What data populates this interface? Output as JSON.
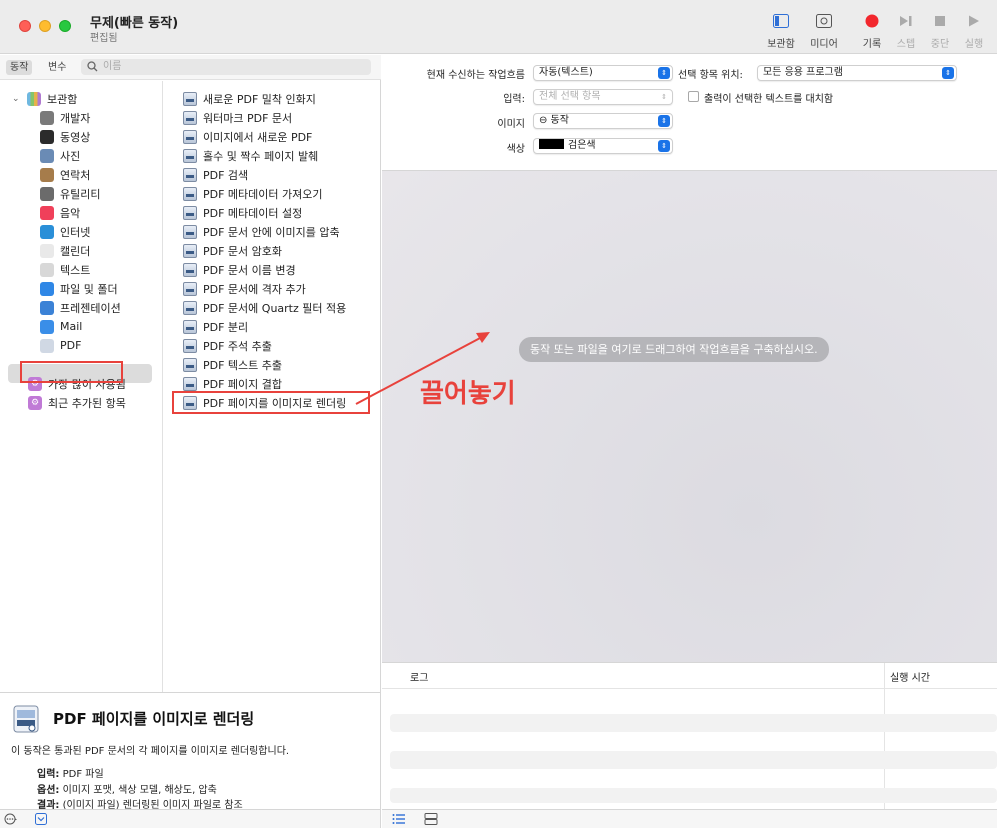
{
  "window": {
    "title": "무제(빠른 동작)",
    "subtitle": "편집됨"
  },
  "toolbar": {
    "library": "보관함",
    "media": "미디어",
    "record": "기록",
    "step": "스텝",
    "stop": "중단",
    "run": "실행"
  },
  "library": {
    "tab_actions": "동작",
    "tab_variables": "변수",
    "search_placeholder": "이름",
    "root": "보관함",
    "categories": [
      {
        "label": "개발자",
        "icon": "hammer-icon",
        "color": "#7a7a7a"
      },
      {
        "label": "동영상",
        "icon": "video-icon",
        "color": "#2b2b2b"
      },
      {
        "label": "사진",
        "icon": "photo-icon",
        "color": "#6a8bb5"
      },
      {
        "label": "연락처",
        "icon": "contacts-icon",
        "color": "#a67c4b"
      },
      {
        "label": "유틸리티",
        "icon": "tools-icon",
        "color": "#6b6b6b"
      },
      {
        "label": "음악",
        "icon": "music-icon",
        "color": "#f0405a"
      },
      {
        "label": "인터넷",
        "icon": "globe-icon",
        "color": "#2a8fd8"
      },
      {
        "label": "캘린더",
        "icon": "calendar-icon",
        "color": "#e9e9e9"
      },
      {
        "label": "텍스트",
        "icon": "text-icon",
        "color": "#d8d8d8"
      },
      {
        "label": "파일 및 폴더",
        "icon": "finder-icon",
        "color": "#2f87e6"
      },
      {
        "label": "프레젠테이션",
        "icon": "presentation-icon",
        "color": "#3b82d6"
      },
      {
        "label": "Mail",
        "icon": "mail-icon",
        "color": "#3a8ee8"
      },
      {
        "label": "PDF",
        "icon": "pdf-icon",
        "color": "#d0d8e4"
      }
    ],
    "smart_groups": [
      {
        "label": "가장 많이 사용됨",
        "icon": "smart-folder-icon"
      },
      {
        "label": "최근 추가된 항목",
        "icon": "smart-folder-icon"
      }
    ],
    "actions": [
      "새로운 PDF 밀착 인화지",
      "워터마크 PDF 문서",
      "이미지에서 새로운 PDF",
      "홀수 및 짝수 페이지 발췌",
      "PDF 검색",
      "PDF 메타데이터 가져오기",
      "PDF 메타데이터 설정",
      "PDF 문서 안에 이미지를 압축",
      "PDF 문서 암호화",
      "PDF 문서 이름 변경",
      "PDF 문서에 격자 추가",
      "PDF 문서에 Quartz 필터 적용",
      "PDF 분리",
      "PDF 주석 추출",
      "PDF 텍스트 추출",
      "PDF 페이지 결합",
      "PDF 페이지를 이미지로 렌더링"
    ]
  },
  "description": {
    "title": "PDF 페이지를 이미지로 렌더링",
    "body": "이 동작은 통과된 PDF 문서의 각 페이지를 이미지로 렌더링합니다.",
    "input_label": "입력:",
    "input_value": "PDF 파일",
    "options_label": "옵션:",
    "options_value": "이미지 포맷, 색상 모델, 해상도, 압축",
    "result_label": "결과:",
    "result_value": "(이미지 파일) 렌더링된 이미지 파일로 참조"
  },
  "workflow_options": {
    "receives_label": "현재 수신하는 작업흐름",
    "receives_value": "자동(텍스트)",
    "location_label": "선택 항목 위치:",
    "location_value": "모든 응용 프로그램",
    "input_label": "입력:",
    "input_value": "전체 선택 항목",
    "replace_label": "출력이 선택한 텍스트를 대치함",
    "image_label": "이미지",
    "image_value": "⊖ 동작",
    "color_label": "색상",
    "color_value": "검은색",
    "color_swatch": "#000000"
  },
  "workflow": {
    "hint": "동작 또는 파일을 여기로 드래그하여 작업흐름을 구축하십시오."
  },
  "log": {
    "col_log": "로그",
    "col_time": "실행 시간"
  },
  "annotation": {
    "text": "끌어놓기",
    "color": "#e8423c"
  }
}
